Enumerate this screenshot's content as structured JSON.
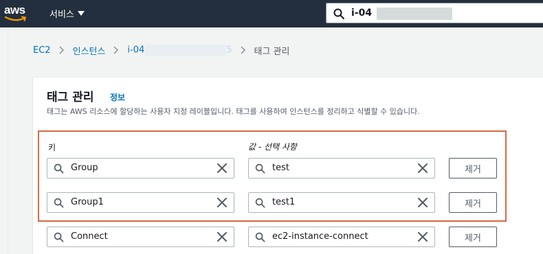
{
  "nav": {
    "logo": "aws",
    "services_label": "서비스",
    "services_icon": "caret-down-icon",
    "search_value": "i-04"
  },
  "breadcrumb": {
    "ec2": "EC2",
    "instances": "인스턴스",
    "instance_id": "i-04",
    "instance_id_tail": "5",
    "current": "태그 관리"
  },
  "panel": {
    "title": "태그 관리",
    "info": "정보",
    "description": "태그는 AWS 리소스에 할당하는 사용자 지정 레이블입니다. 태그를 사용하여 인스턴스를 정리하고 식별할 수 있습니다.",
    "key_label": "키",
    "value_label": "값 - 선택 사항",
    "remove_label": "제거"
  },
  "tags": [
    {
      "key": "Group",
      "value": "test"
    },
    {
      "key": "Group1",
      "value": "test1"
    },
    {
      "key": "Connect",
      "value": "ec2-instance-connect"
    }
  ],
  "colors": {
    "nav_bg": "#232f3e",
    "link": "#0073bb",
    "highlight_border": "#d86942",
    "aws_orange": "#ff9900"
  }
}
